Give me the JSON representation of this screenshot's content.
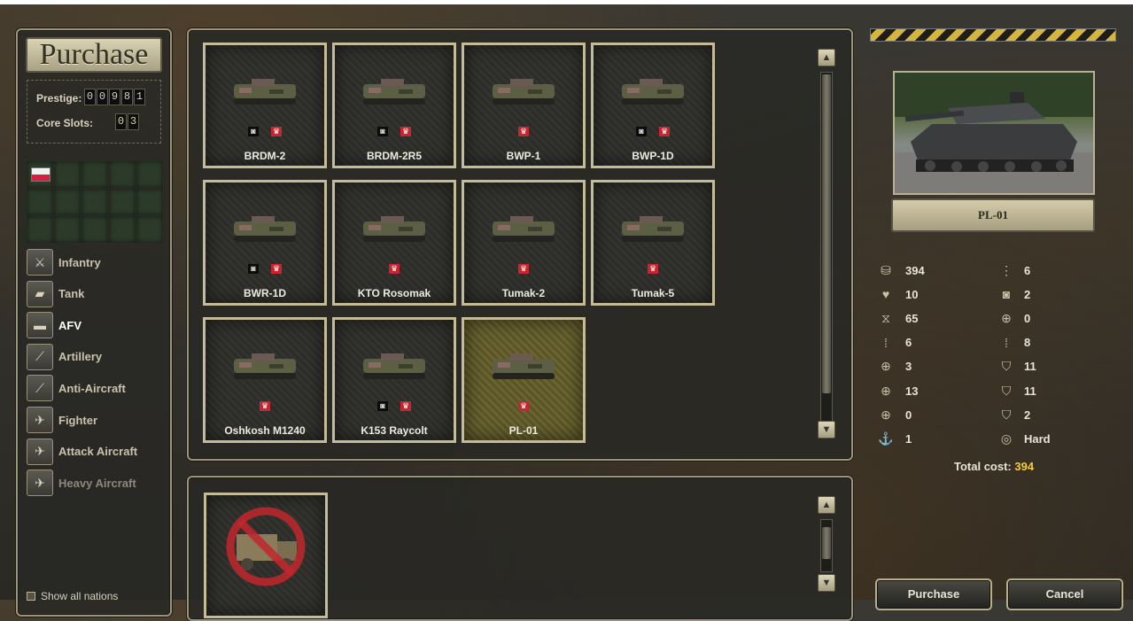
{
  "left_panel": {
    "title": "Purchase",
    "prestige_label": "Prestige:",
    "prestige_digits": [
      "0",
      "0",
      "9",
      "8",
      "1"
    ],
    "core_slots_label": "Core Slots:",
    "core_slots_digits": [
      "0",
      "3"
    ],
    "categories": [
      {
        "label": "Infantry",
        "icon": "infantry-icon",
        "state": "normal"
      },
      {
        "label": "Tank",
        "icon": "tank-icon",
        "state": "normal"
      },
      {
        "label": "AFV",
        "icon": "afv-icon",
        "state": "active"
      },
      {
        "label": "Artillery",
        "icon": "artillery-icon",
        "state": "normal"
      },
      {
        "label": "Anti-Aircraft",
        "icon": "anti-aircraft-icon",
        "state": "normal"
      },
      {
        "label": "Fighter",
        "icon": "fighter-icon",
        "state": "normal"
      },
      {
        "label": "Attack Aircraft",
        "icon": "attack-aircraft-icon",
        "state": "normal"
      },
      {
        "label": "Heavy Aircraft",
        "icon": "heavy-aircraft-icon",
        "state": "dim"
      }
    ],
    "show_all_label": "Show all nations"
  },
  "units": [
    {
      "name": "BRDM-2",
      "recon": true,
      "selected": false
    },
    {
      "name": "BRDM-2R5",
      "recon": true,
      "selected": false
    },
    {
      "name": "BWP-1",
      "recon": false,
      "selected": false
    },
    {
      "name": "BWP-1D",
      "recon": true,
      "selected": false
    },
    {
      "name": "BWR-1D",
      "recon": true,
      "selected": false
    },
    {
      "name": "KTO Rosomak",
      "recon": false,
      "selected": false
    },
    {
      "name": "Tumak-2",
      "recon": false,
      "selected": false
    },
    {
      "name": "Tumak-5",
      "recon": false,
      "selected": false
    },
    {
      "name": "Oshkosh M1240",
      "recon": false,
      "selected": false
    },
    {
      "name": "K153 Raycolt",
      "recon": true,
      "selected": false
    },
    {
      "name": "PL-01",
      "recon": false,
      "selected": true
    }
  ],
  "detail": {
    "unit_name": "PL-01",
    "stats_left": [
      {
        "icon": "cost-icon",
        "value": "394"
      },
      {
        "icon": "strength-icon",
        "value": "10"
      },
      {
        "icon": "fuel-icon",
        "value": "65"
      },
      {
        "icon": "ammo-icon",
        "value": "6"
      },
      {
        "icon": "soft-attack-icon",
        "value": "3"
      },
      {
        "icon": "hard-attack-icon",
        "value": "13"
      },
      {
        "icon": "air-attack-icon",
        "value": "0"
      },
      {
        "icon": "naval-attack-icon",
        "value": "1"
      }
    ],
    "stats_right": [
      {
        "icon": "movement-icon",
        "value": "6"
      },
      {
        "icon": "spotting-icon",
        "value": "2"
      },
      {
        "icon": "range-icon",
        "value": "0"
      },
      {
        "icon": "initiative-icon",
        "value": "8"
      },
      {
        "icon": "ground-defense-icon",
        "value": "11"
      },
      {
        "icon": "air-defense-icon",
        "value": "11"
      },
      {
        "icon": "close-defense-icon",
        "value": "2"
      },
      {
        "icon": "target-type-icon",
        "value": "Hard"
      }
    ],
    "total_label": "Total cost:",
    "total_value": "394"
  },
  "buttons": {
    "purchase": "Purchase",
    "cancel": "Cancel"
  },
  "colors": {
    "accent_gold": "#f0cd3c",
    "flag_red": "#d4213d",
    "badge_red": "#c92530"
  }
}
